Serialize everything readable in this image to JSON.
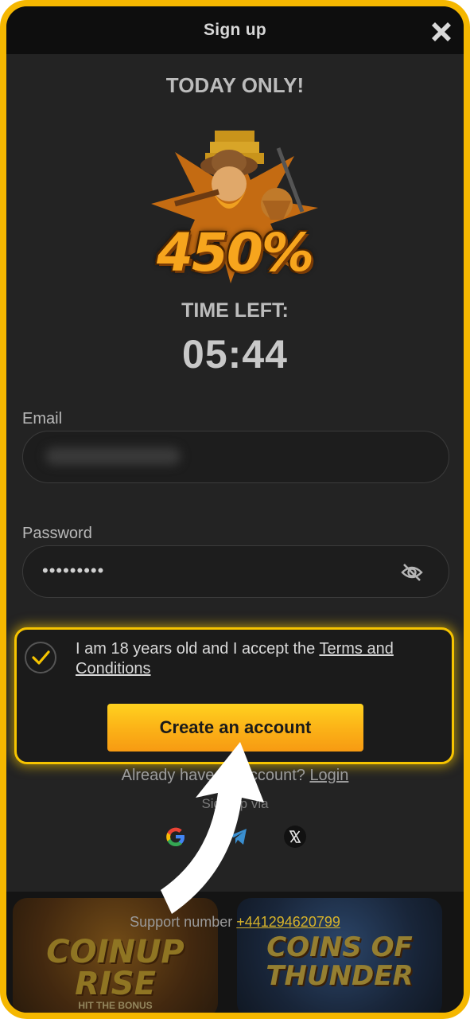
{
  "header": {
    "title": "Sign up",
    "close_icon": "close-icon"
  },
  "promo": {
    "label": "TODAY ONLY!",
    "bonus": "450%",
    "timer_label": "TIME LEFT:",
    "timer_value": "05:44"
  },
  "form": {
    "email_label": "Email",
    "password_label": "Password",
    "password_value": "•••••••••",
    "eye_icon": "eye-slash-icon"
  },
  "consent": {
    "checked": true,
    "text": "I am 18 years old and I accept the ",
    "link": "Terms and Conditions"
  },
  "create_button": "Create an account",
  "login": {
    "text": "Already have an account? ",
    "link": "Login"
  },
  "signup_via": "Sign up via",
  "socials": [
    "google-icon",
    "telegram-icon",
    "x-icon"
  ],
  "support": {
    "text": "Support number ",
    "number": "+441294620799"
  },
  "games": [
    {
      "title": "COINUP RISE",
      "subtitle": "HIT THE BONUS"
    },
    {
      "title": "COINS OF THUNDER",
      "subtitle": ""
    }
  ],
  "colors": {
    "accent": "#f6c400",
    "button_top": "#ffd21f",
    "button_bottom": "#f79a12",
    "background": "#232323"
  }
}
